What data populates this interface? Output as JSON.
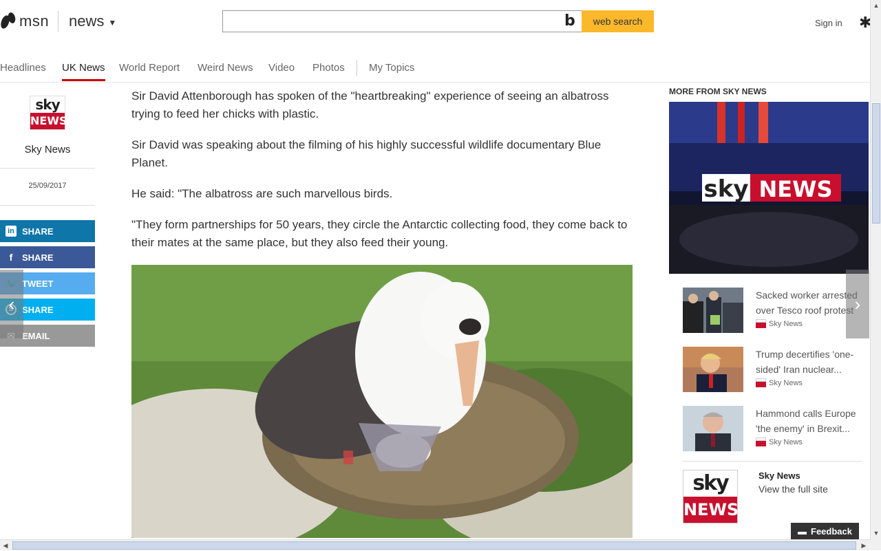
{
  "header": {
    "logo_text": "msn",
    "section_label": "news",
    "search_placeholder": "",
    "search_button": "web search",
    "sign_in": "Sign in"
  },
  "nav": {
    "items": [
      "Headlines",
      "UK News",
      "World Report",
      "Weird News",
      "Video",
      "Photos",
      "My Topics"
    ],
    "active": "UK News"
  },
  "source": {
    "logo_top": "sky",
    "logo_bottom": "NEWS",
    "name": "Sky News",
    "date": "25/09/2017"
  },
  "share": {
    "linkedin": "SHARE",
    "facebook": "SHARE",
    "twitter": "TWEET",
    "skype": "SHARE",
    "email": "EMAIL"
  },
  "article": {
    "paragraphs": [
      "Sir David Attenborough has spoken of the \"heartbreaking\" experience of seeing an albatross trying to feed her chicks with plastic.",
      "Sir David was speaking about the filming of his highly successful wildlife documentary Blue Planet.",
      "He said: \"The albatross are such marvellous birds.",
      "\"They form partnerships for 50 years, they circle the Antarctic collecting food, they come back to their mates at the same place, but they also feed their young."
    ]
  },
  "right": {
    "heading": "MORE FROM SKY NEWS",
    "hero_logo_sky": "sky",
    "hero_logo_news": "NEWS",
    "stories": [
      {
        "title": "Sacked worker arrested over Tesco roof protest",
        "source": "Sky News"
      },
      {
        "title": "Trump decertifies 'one-sided' Iran nuclear...",
        "source": "Sky News"
      },
      {
        "title": "Hammond calls Europe 'the enemy' in Brexit...",
        "source": "Sky News"
      }
    ],
    "site_name": "Sky News",
    "view_site": "View the full site",
    "big_logo_top": "sky",
    "big_logo_bottom": "NEWS"
  },
  "feedback": "Feedback",
  "colors": {
    "search_button": "#fbb82b",
    "nav_active_underline": "#cc0000",
    "sky_red": "#c8102e",
    "linkedin": "#0e76a8",
    "facebook": "#3b5998",
    "twitter": "#55acee",
    "skype": "#00aff0",
    "email": "#999999"
  }
}
